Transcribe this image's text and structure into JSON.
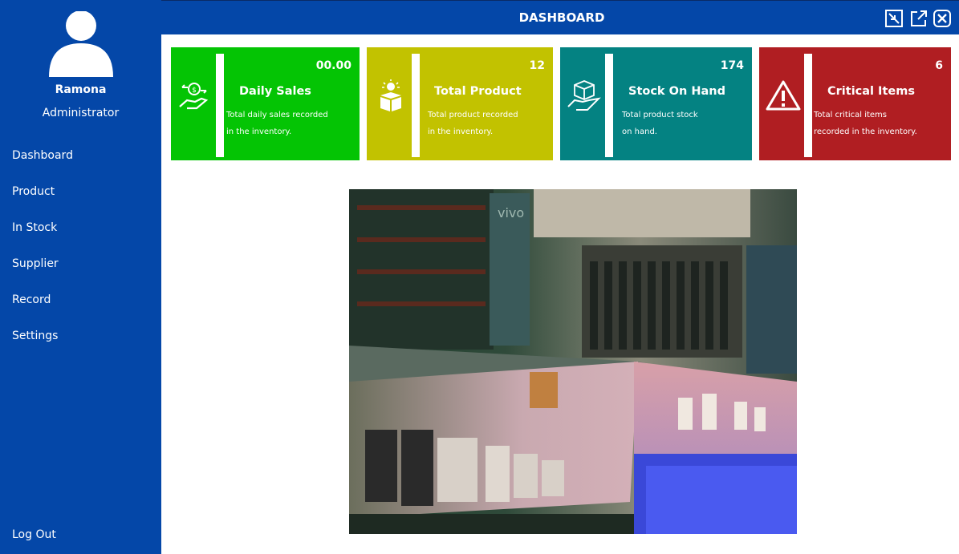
{
  "window": {
    "title": "DASHBOARD",
    "controls": [
      "minimize-icon",
      "popout-icon",
      "close-icon"
    ]
  },
  "user": {
    "name": "Ramona",
    "role": "Administrator"
  },
  "sidebar": {
    "items": [
      {
        "label": "Dashboard"
      },
      {
        "label": "Product"
      },
      {
        "label": "In Stock"
      },
      {
        "label": "Supplier"
      },
      {
        "label": "Record"
      },
      {
        "label": "Settings"
      }
    ],
    "logout": "Log Out"
  },
  "cards": [
    {
      "title": "Daily Sales",
      "value": "00.00",
      "desc_line1": "Total daily sales recorded",
      "desc_line2": "in the inventory.",
      "color": "#04c404",
      "icon": "sales-hand-icon"
    },
    {
      "title": "Total Product",
      "value": "12",
      "desc_line1": "Total product recorded",
      "desc_line2": "in the inventory.",
      "color": "#c2c200",
      "icon": "product-box-icon"
    },
    {
      "title": "Stock On Hand",
      "value": "174",
      "desc_line1": "Total product stock",
      "desc_line2": "on hand.",
      "color": "#048282",
      "icon": "stock-hand-icon"
    },
    {
      "title": "Critical Items",
      "value": "6",
      "desc_line1": "Total critical items",
      "desc_line2": "recorded in the inventory.",
      "color": "#b01e22",
      "icon": "warning-icon"
    }
  ],
  "photo": {
    "subject": "store-interior-photo",
    "sign_text": "vivo"
  },
  "colors": {
    "sidebar": "#0447a8",
    "titlebar": "#0447a8"
  }
}
